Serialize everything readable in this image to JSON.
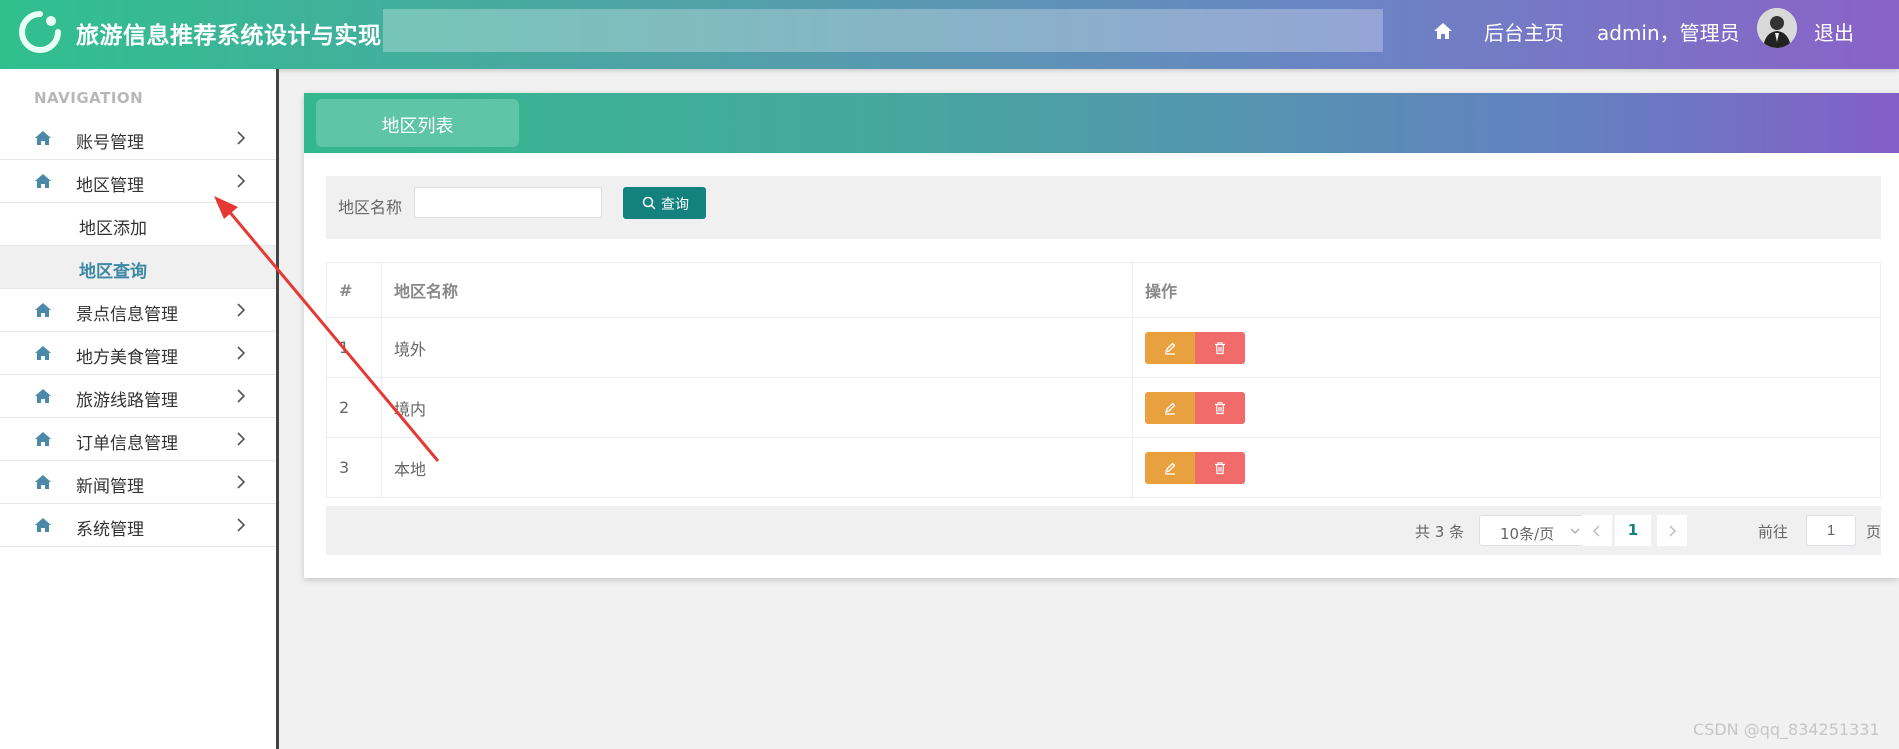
{
  "header": {
    "title": "旅游信息推荐系统设计与实现",
    "home_label": "后台主页",
    "user_label": "admin，管理员",
    "logout_label": "退出",
    "logo_icon": "refresh-ring-icon",
    "home_icon": "home-icon",
    "avatar": "user-avatar"
  },
  "sidebar": {
    "nav_heading": "NAVIGATION",
    "items": [
      {
        "label": "账号管理",
        "icon": "home-icon",
        "expanded": false
      },
      {
        "label": "地区管理",
        "icon": "home-icon",
        "expanded": true,
        "children": [
          "地区添加",
          "地区查询"
        ],
        "active_child": "地区查询"
      },
      {
        "label": "景点信息管理",
        "icon": "home-icon",
        "expanded": false
      },
      {
        "label": "地方美食管理",
        "icon": "home-icon",
        "expanded": false
      },
      {
        "label": "旅游线路管理",
        "icon": "home-icon",
        "expanded": false
      },
      {
        "label": "订单信息管理",
        "icon": "home-icon",
        "expanded": false
      },
      {
        "label": "新闻管理",
        "icon": "home-icon",
        "expanded": false
      },
      {
        "label": "系统管理",
        "icon": "home-icon",
        "expanded": false
      }
    ]
  },
  "main": {
    "tab_label": "地区列表",
    "search": {
      "label": "地区名称",
      "value": "",
      "button_label": "查询",
      "button_icon": "search-icon"
    },
    "table": {
      "headers": [
        "#",
        "地区名称",
        "操作"
      ],
      "rows": [
        {
          "index": "1",
          "name": "境外"
        },
        {
          "index": "2",
          "name": "境内"
        },
        {
          "index": "3",
          "name": "本地"
        }
      ],
      "row_actions": [
        "edit-icon",
        "trash-icon"
      ]
    },
    "pagination": {
      "total_label": "共 3 条",
      "page_size_label": "10条/页",
      "current_page": "1",
      "goto_label": "前往",
      "goto_value": "1",
      "goto_unit": "页"
    }
  },
  "watermark": "CSDN @qq_834251331",
  "colors": {
    "header_start": "#30c08e",
    "header_end": "#8a62c8",
    "primary": "#13827f",
    "edit": "#e9a13f",
    "delete": "#f26b6b",
    "annotation_arrow": "#e53935"
  }
}
